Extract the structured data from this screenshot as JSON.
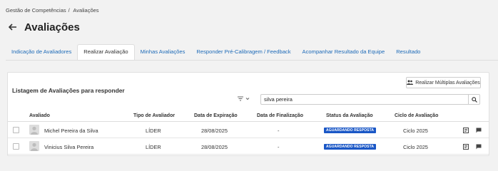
{
  "breadcrumb": {
    "item1": "Gestão de Competências",
    "separator": "/",
    "item2": "Avaliações"
  },
  "page": {
    "title": "Avaliações"
  },
  "tabs": [
    {
      "label": "Indicação de Avaliadores"
    },
    {
      "label": "Realizar Avaliação"
    },
    {
      "label": "Minhas Avaliações"
    },
    {
      "label": "Responder Pré-Calibragem / Feedback"
    },
    {
      "label": "Acompanhar Resultado da Equipe"
    },
    {
      "label": "Resultado"
    }
  ],
  "active_tab": "Realizar Avaliação",
  "panel": {
    "title": "Listagem de Avaliações para responder",
    "multi_button": "Realizar Múltiplas Avaliações",
    "search_value": "silva pereira"
  },
  "table": {
    "headers": [
      "Avaliado",
      "Tipo de Avaliador",
      "Data de Expiração",
      "Data de Finalização",
      "Status da Avaliação",
      "Ciclo de Avaliação"
    ],
    "rows": [
      {
        "name": "Michel Pereira da Silva",
        "tipo": "LÍDER",
        "expiracao": "28/08/2025",
        "finalizacao": "-",
        "status": "AGUARDANDO RESPOSTA",
        "ciclo": "Ciclo 2025"
      },
      {
        "name": "Vinicius Silva Pereira",
        "tipo": "LÍDER",
        "expiracao": "28/08/2025",
        "finalizacao": "-",
        "status": "AGUARDANDO RESPOSTA",
        "ciclo": "Ciclo 2025"
      }
    ]
  },
  "colors": {
    "link": "#1e6bb8",
    "badge": "#1a57c6"
  },
  "icons": {
    "back": "arrow-left-icon",
    "users": "users-icon",
    "filter": "filter-icon",
    "search": "search-icon",
    "evaluate": "form-icon",
    "feedback": "chat-icon"
  }
}
